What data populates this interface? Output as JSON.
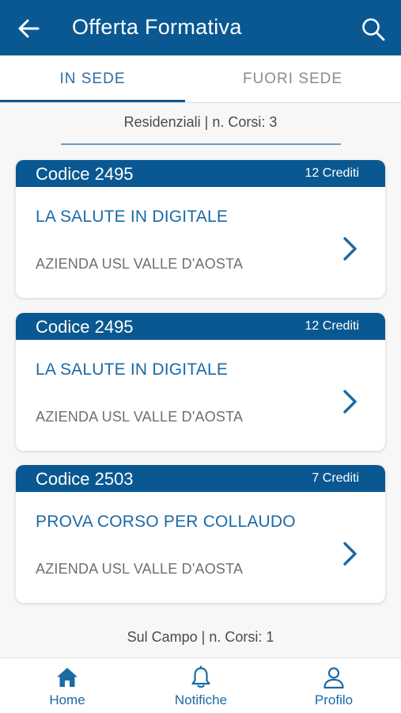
{
  "appbar": {
    "title": "Offerta Formativa"
  },
  "tabs": [
    {
      "label": "IN SEDE",
      "active": true
    },
    {
      "label": "FUORI SEDE",
      "active": false
    }
  ],
  "sections": [
    {
      "label": "Residenziali | n. Corsi: 3"
    },
    {
      "label": "Sul Campo | n. Corsi: 1"
    }
  ],
  "courses": [
    {
      "code": "Codice 2495",
      "credits": "12 Crediti",
      "title": "LA SALUTE IN DIGITALE",
      "org": "AZIENDA USL VALLE D'AOSTA"
    },
    {
      "code": "Codice 2495",
      "credits": "12 Crediti",
      "title": "LA SALUTE IN DIGITALE",
      "org": "AZIENDA USL VALLE D'AOSTA"
    },
    {
      "code": "Codice 2503",
      "credits": "7 Crediti",
      "title": "PROVA CORSO PER COLLAUDO",
      "org": "AZIENDA USL VALLE D'AOSTA"
    }
  ],
  "bottom_nav": [
    {
      "label": "Home",
      "icon": "home-icon"
    },
    {
      "label": "Notifiche",
      "icon": "bell-icon"
    },
    {
      "label": "Profilo",
      "icon": "user-icon"
    }
  ],
  "colors": {
    "primary": "#0a5891",
    "accent_text": "#1a6aa5",
    "muted": "#8c8c8c"
  }
}
